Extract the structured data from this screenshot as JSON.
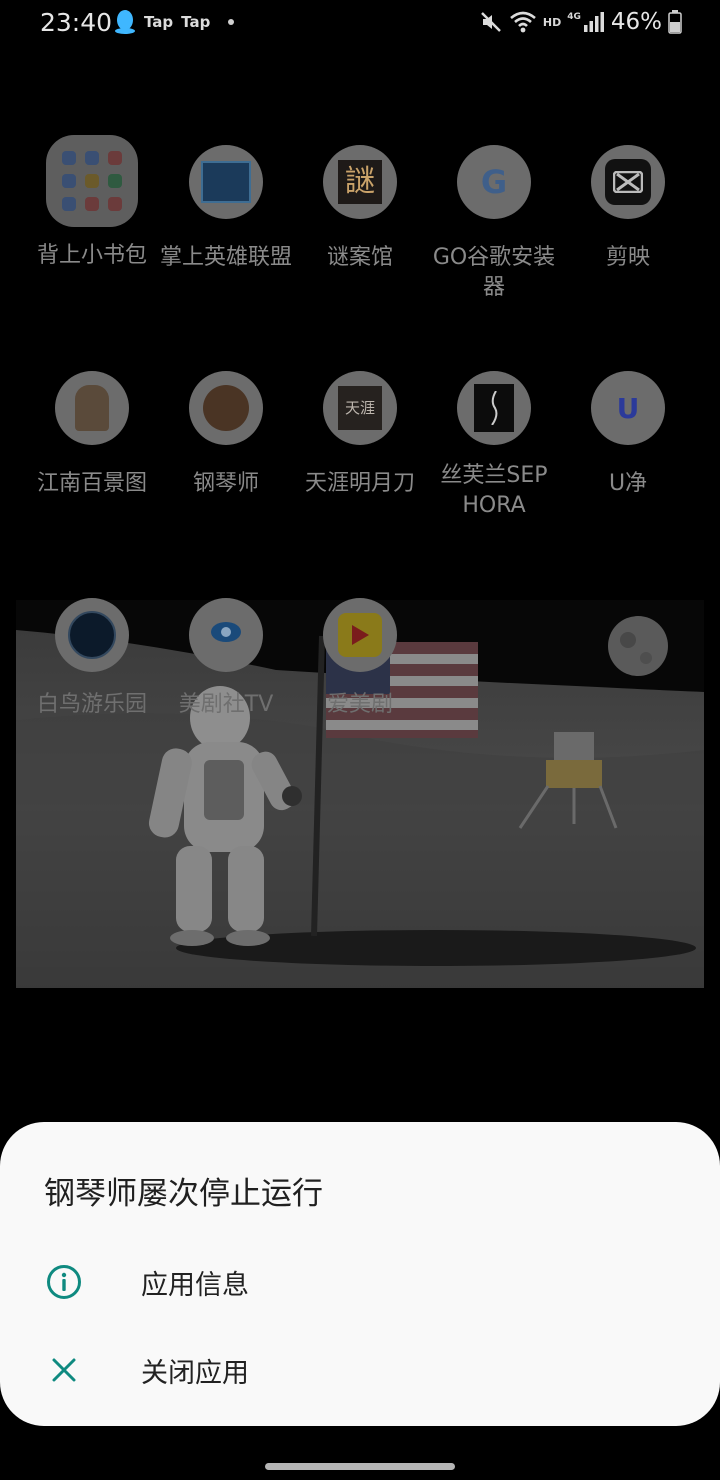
{
  "status_bar": {
    "time": "23:40",
    "notifications": [
      "qq-icon",
      "taptap-icon",
      "taptap-icon",
      "more-dot"
    ],
    "tap_label_1": "Tap",
    "tap_label_2": "Tap",
    "hd_label": "HD",
    "network_label": "4G",
    "battery_percent": "46%"
  },
  "apps": [
    {
      "label": "背上小书包",
      "icon": "folder"
    },
    {
      "label": "掌上英雄联盟",
      "icon": "league-icon"
    },
    {
      "label": "谜案馆",
      "icon": "mystery-icon",
      "glyph": "謎"
    },
    {
      "label": "GO谷歌安装器",
      "icon": "google-installer-icon",
      "glyph": "G"
    },
    {
      "label": "剪映",
      "icon": "capcut-icon"
    },
    {
      "label": "江南百景图",
      "icon": "jiangnan-icon"
    },
    {
      "label": "钢琴师",
      "icon": "pianist-icon"
    },
    {
      "label": "天涯明月刀",
      "icon": "tianya-icon",
      "glyph": "天涯"
    },
    {
      "label": "丝芙兰SEPHORA",
      "icon": "sephora-icon"
    },
    {
      "label": "U净",
      "icon": "ujing-icon",
      "glyph": "U"
    },
    {
      "label": "白鸟游乐园",
      "icon": "bird-park-icon"
    },
    {
      "label": "美剧社TV",
      "icon": "meijushe-icon"
    },
    {
      "label": "爱美剧",
      "icon": "aimeiju-icon"
    }
  ],
  "dialog": {
    "title": "钢琴师屡次停止运行",
    "options": [
      {
        "label": "应用信息",
        "icon": "info-icon"
      },
      {
        "label": "关闭应用",
        "icon": "close-icon"
      }
    ]
  },
  "colors": {
    "accent": "#0f8a80",
    "sheet_bg": "#f9f9f9"
  }
}
